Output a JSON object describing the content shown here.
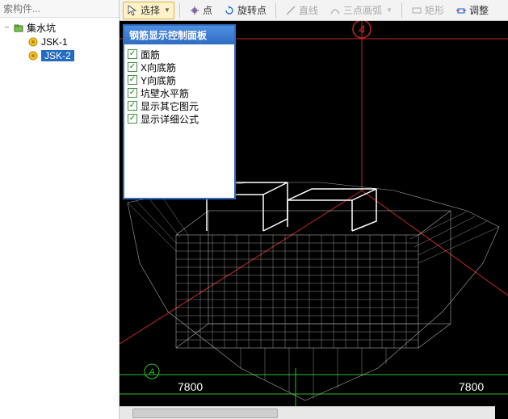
{
  "search": {
    "placeholder": "索构件..."
  },
  "tree": {
    "root": {
      "label": "集水坑"
    },
    "items": [
      {
        "label": "JSK-1"
      },
      {
        "label": "JSK-2",
        "selected": true
      }
    ]
  },
  "toolbar": {
    "select": "选择",
    "point": "点",
    "rotate_point": "旋转点",
    "line": "直线",
    "arc3": "三点画弧",
    "rect": "矩形",
    "adjust": "调整"
  },
  "float_panel": {
    "title": "钢筋显示控制面板",
    "options": [
      "面筋",
      "X向底筋",
      "Y向底筋",
      "坑壁水平筋",
      "显示其它图元",
      "显示详细公式"
    ]
  },
  "viewport": {
    "axis_marker": "4",
    "point_a_label": "A",
    "dim_left": "7800",
    "dim_right": "7800"
  },
  "icons": {
    "search": "search-icon",
    "cursor": "cursor-icon",
    "cross": "cross-icon",
    "rotate": "rotate-icon",
    "line": "line-icon",
    "arc": "arc-icon",
    "rect": "rect-icon",
    "adjust": "adjust-icon",
    "folder": "folder-icon",
    "node": "node-icon"
  }
}
